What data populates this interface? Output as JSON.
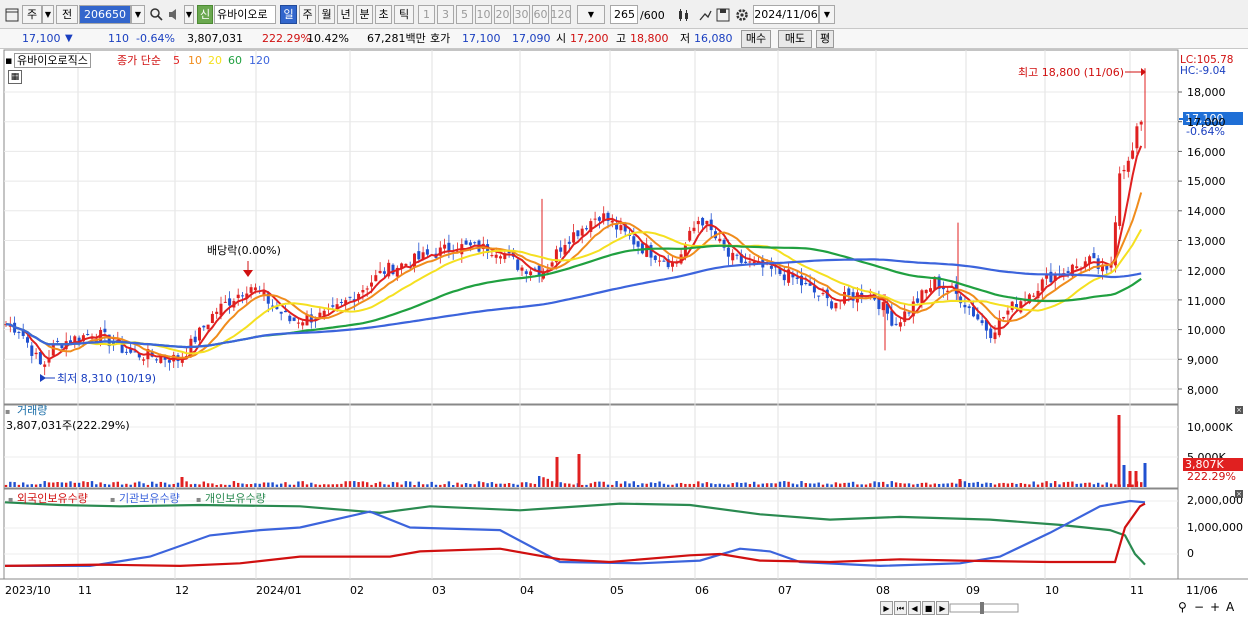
{
  "toolbar": {
    "jong": "주",
    "jeon": "전",
    "code": "206650",
    "shin": "신",
    "name": "유바이오로",
    "periods": [
      "일",
      "주",
      "월",
      "년",
      "분",
      "초",
      "틱"
    ],
    "active_period": "일",
    "ticks": [
      "1",
      "3",
      "5",
      "10",
      "20",
      "30",
      "60",
      "120"
    ],
    "count": "265",
    "count_total": "/600",
    "date": "2024/11/06"
  },
  "info": {
    "price": "17,100",
    "change": "110",
    "change_pct": "-0.64%",
    "volume": "3,807,031",
    "vol_ratio": "222.29%",
    "turnover": "10.42%",
    "amount": "67,281백만",
    "hoga_label": "호가",
    "ask": "17,100",
    "bid": "17,090",
    "open_label": "시",
    "open": "17,200",
    "high_label": "고",
    "high": "18,800",
    "low_label": "저",
    "low": "16,080",
    "buy": "매수",
    "sell": "매도",
    "pyeong": "평"
  },
  "price_panel": {
    "title": "유바이오로직스",
    "indicator": "종가 단순",
    "ma_labels": [
      "5",
      "10",
      "20",
      "60",
      "120"
    ],
    "ma_colors": [
      "#e02020",
      "#f08c1c",
      "#f5e020",
      "#20a040",
      "#3c64dc"
    ],
    "lc": "LC:105.78",
    "hc": "HC:-9.04",
    "high_note": "최고 18,800 (11/06)",
    "low_note": "최저 8,310 (10/19)",
    "div_note": "배당락(0.00%)",
    "current_price": "17,100",
    "current_pct": "-0.64%",
    "y_ticks": [
      "18,000",
      "17,000",
      "16,000",
      "15,000",
      "14,000",
      "13,000",
      "12,000",
      "11,000",
      "10,000",
      "9,000",
      "8,000"
    ]
  },
  "volume_panel": {
    "title": "거래량",
    "value": "3,807,031주(222.29%)",
    "y_ticks": [
      "10,000K",
      "5,000K"
    ],
    "current": "3,807K",
    "current_pct": "222.29%"
  },
  "holding_panel": {
    "legend": [
      {
        "label": "외국인보유수량",
        "color": "#d01010"
      },
      {
        "label": "기관보유수량",
        "color": "#3c64dc"
      },
      {
        "label": "개인보유수량",
        "color": "#2a8a50"
      }
    ],
    "y_ticks": [
      "2,000,000",
      "1,000,000",
      "0"
    ]
  },
  "x_axis": [
    "2023/10",
    "11",
    "12",
    "2024/01",
    "02",
    "03",
    "04",
    "05",
    "06",
    "07",
    "08",
    "09",
    "10",
    "11",
    "11/06"
  ]
}
